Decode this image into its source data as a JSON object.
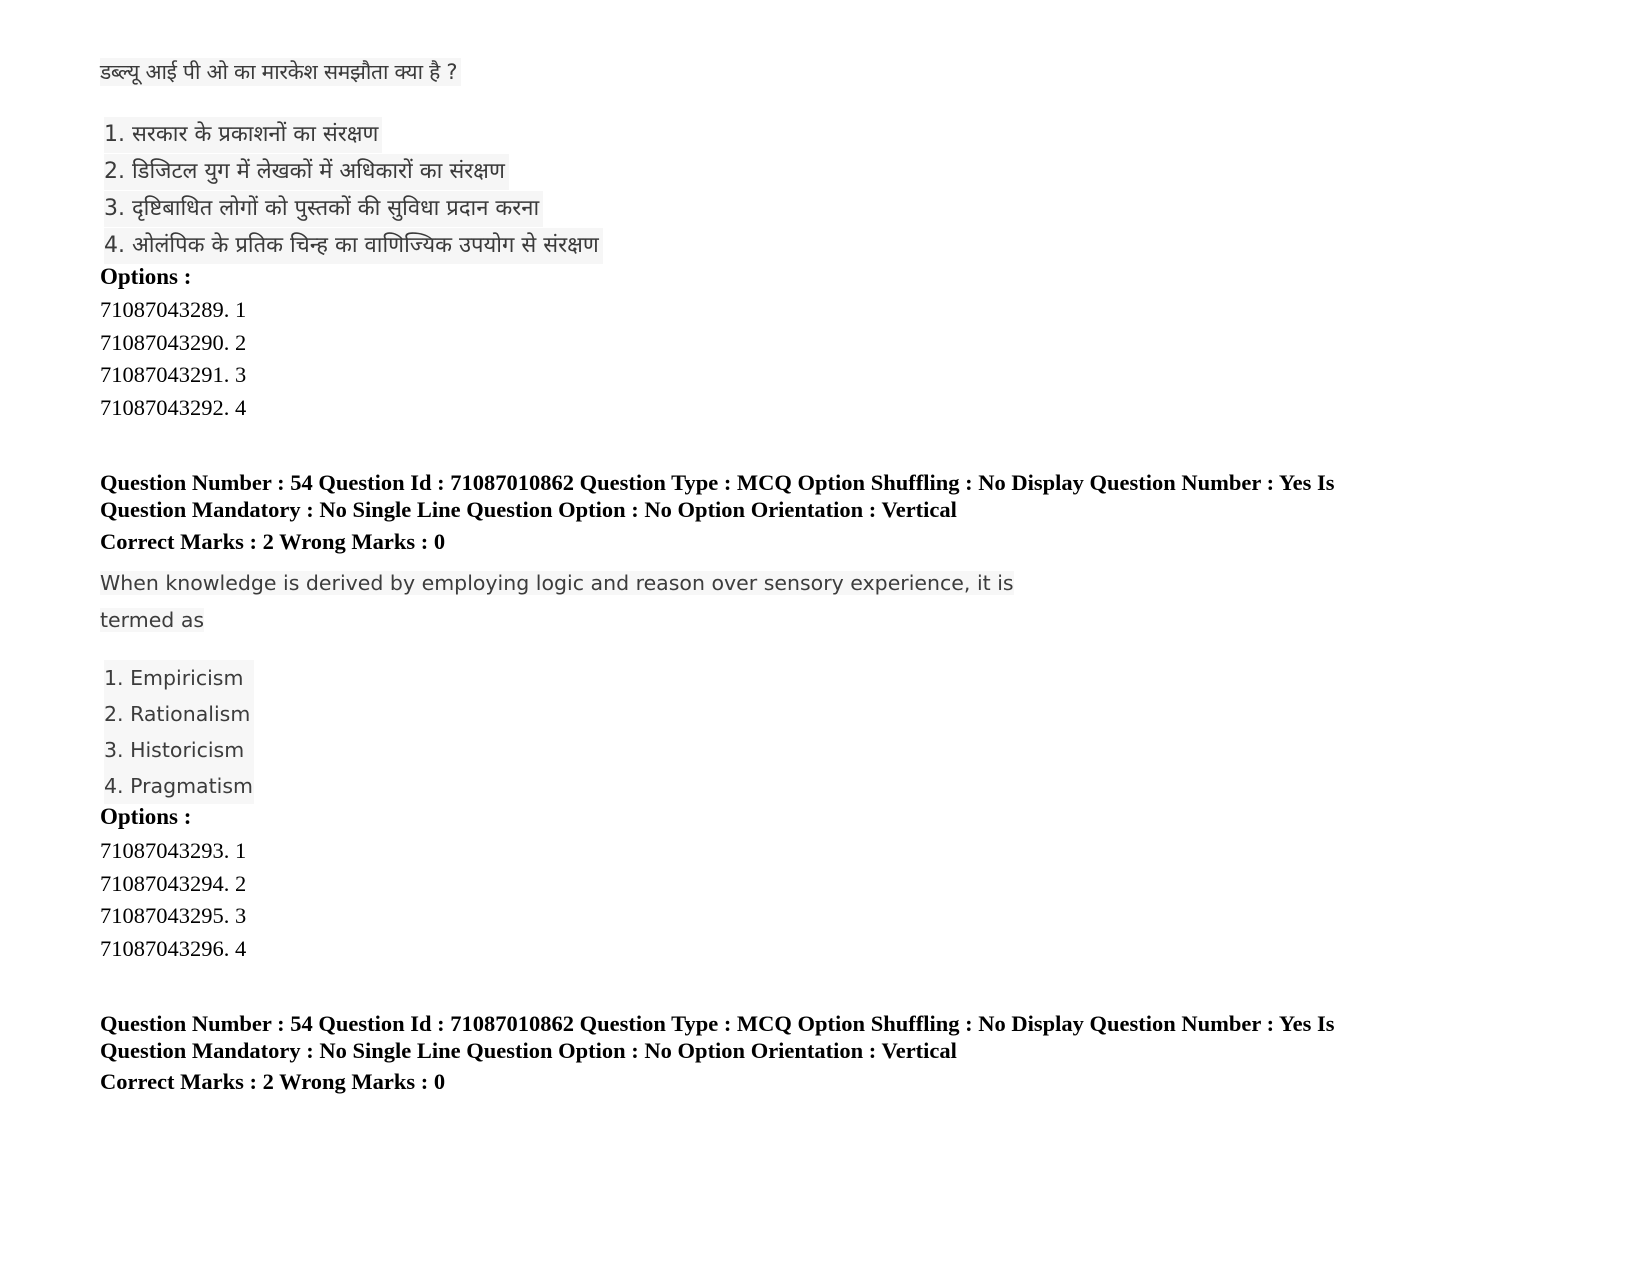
{
  "previous_question": {
    "text": "डब्ल्यू आई पी ओ का मारकेश समझौता क्या है ?",
    "choices": [
      "1. सरकार के प्रकाशनों का संरक्षण",
      "2. डिजिटल युग में लेखकों में अधिकारों का संरक्षण",
      "3. दृष्टिबाधित लोगों को पुस्तकों की सुविधा प्रदान करना",
      "4. ओलंपिक के प्रतिक चिन्ह का वाणिज्यिक उपयोग से संरक्षण"
    ],
    "options_label": "Options :",
    "options": [
      "71087043289. 1",
      "71087043290. 2",
      "71087043291. 3",
      "71087043292. 4"
    ]
  },
  "question_54": {
    "meta_line1": "Question Number : 54 Question Id : 71087010862 Question Type : MCQ Option Shuffling : No Display Question Number : Yes Is",
    "meta_line2": "Question Mandatory : No Single Line Question Option : No Option Orientation : Vertical",
    "marks": "Correct Marks : 2 Wrong Marks : 0",
    "text_line1": "When knowledge is derived by employing logic and reason over sensory experience, it is",
    "text_line2": "termed as",
    "choices": [
      "1. Empiricism",
      "2. Rationalism",
      "3. Historicism",
      "4. Pragmatism"
    ],
    "options_label": "Options :",
    "options": [
      "71087043293. 1",
      "71087043294. 2",
      "71087043295. 3",
      "71087043296. 4"
    ]
  },
  "next_question": {
    "meta_line1": "Question Number : 54 Question Id : 71087010862 Question Type : MCQ Option Shuffling : No Display Question Number : Yes Is",
    "meta_line2": "Question Mandatory : No Single Line Question Option : No Option Orientation : Vertical",
    "marks": "Correct Marks : 2 Wrong Marks : 0"
  }
}
